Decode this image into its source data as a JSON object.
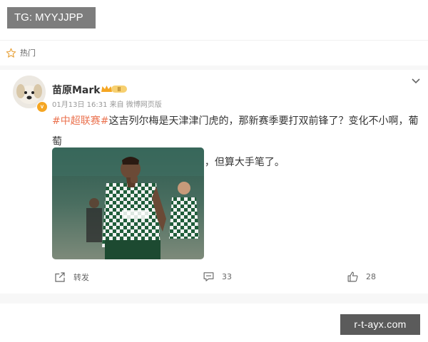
{
  "watermark_top": "TG: MYYJJPP",
  "section": {
    "label": "热门",
    "icon": "hot-star-icon"
  },
  "post": {
    "user_name": "苗原Mark",
    "vip_level": "II",
    "time": "01月13日 16:31 来自 微博网页版",
    "hashtag": "#中超联赛#",
    "text_line1": "这吉列尔梅是天津津门虎的，那新赛季要打双前锋了？变化不小啊，葡萄",
    "text_line2": "牙人说转会费70万欧，可能有偏差，但算大手笔了。",
    "image": "photo of footballer in green-white checkered kit"
  },
  "actions": {
    "repost_label": "转发",
    "comment_count": "33",
    "like_count": "28"
  },
  "watermark_bottom": "r-t-ayx.com",
  "colors": {
    "hashtag": "#eb7350",
    "vip": "#f5a623"
  }
}
